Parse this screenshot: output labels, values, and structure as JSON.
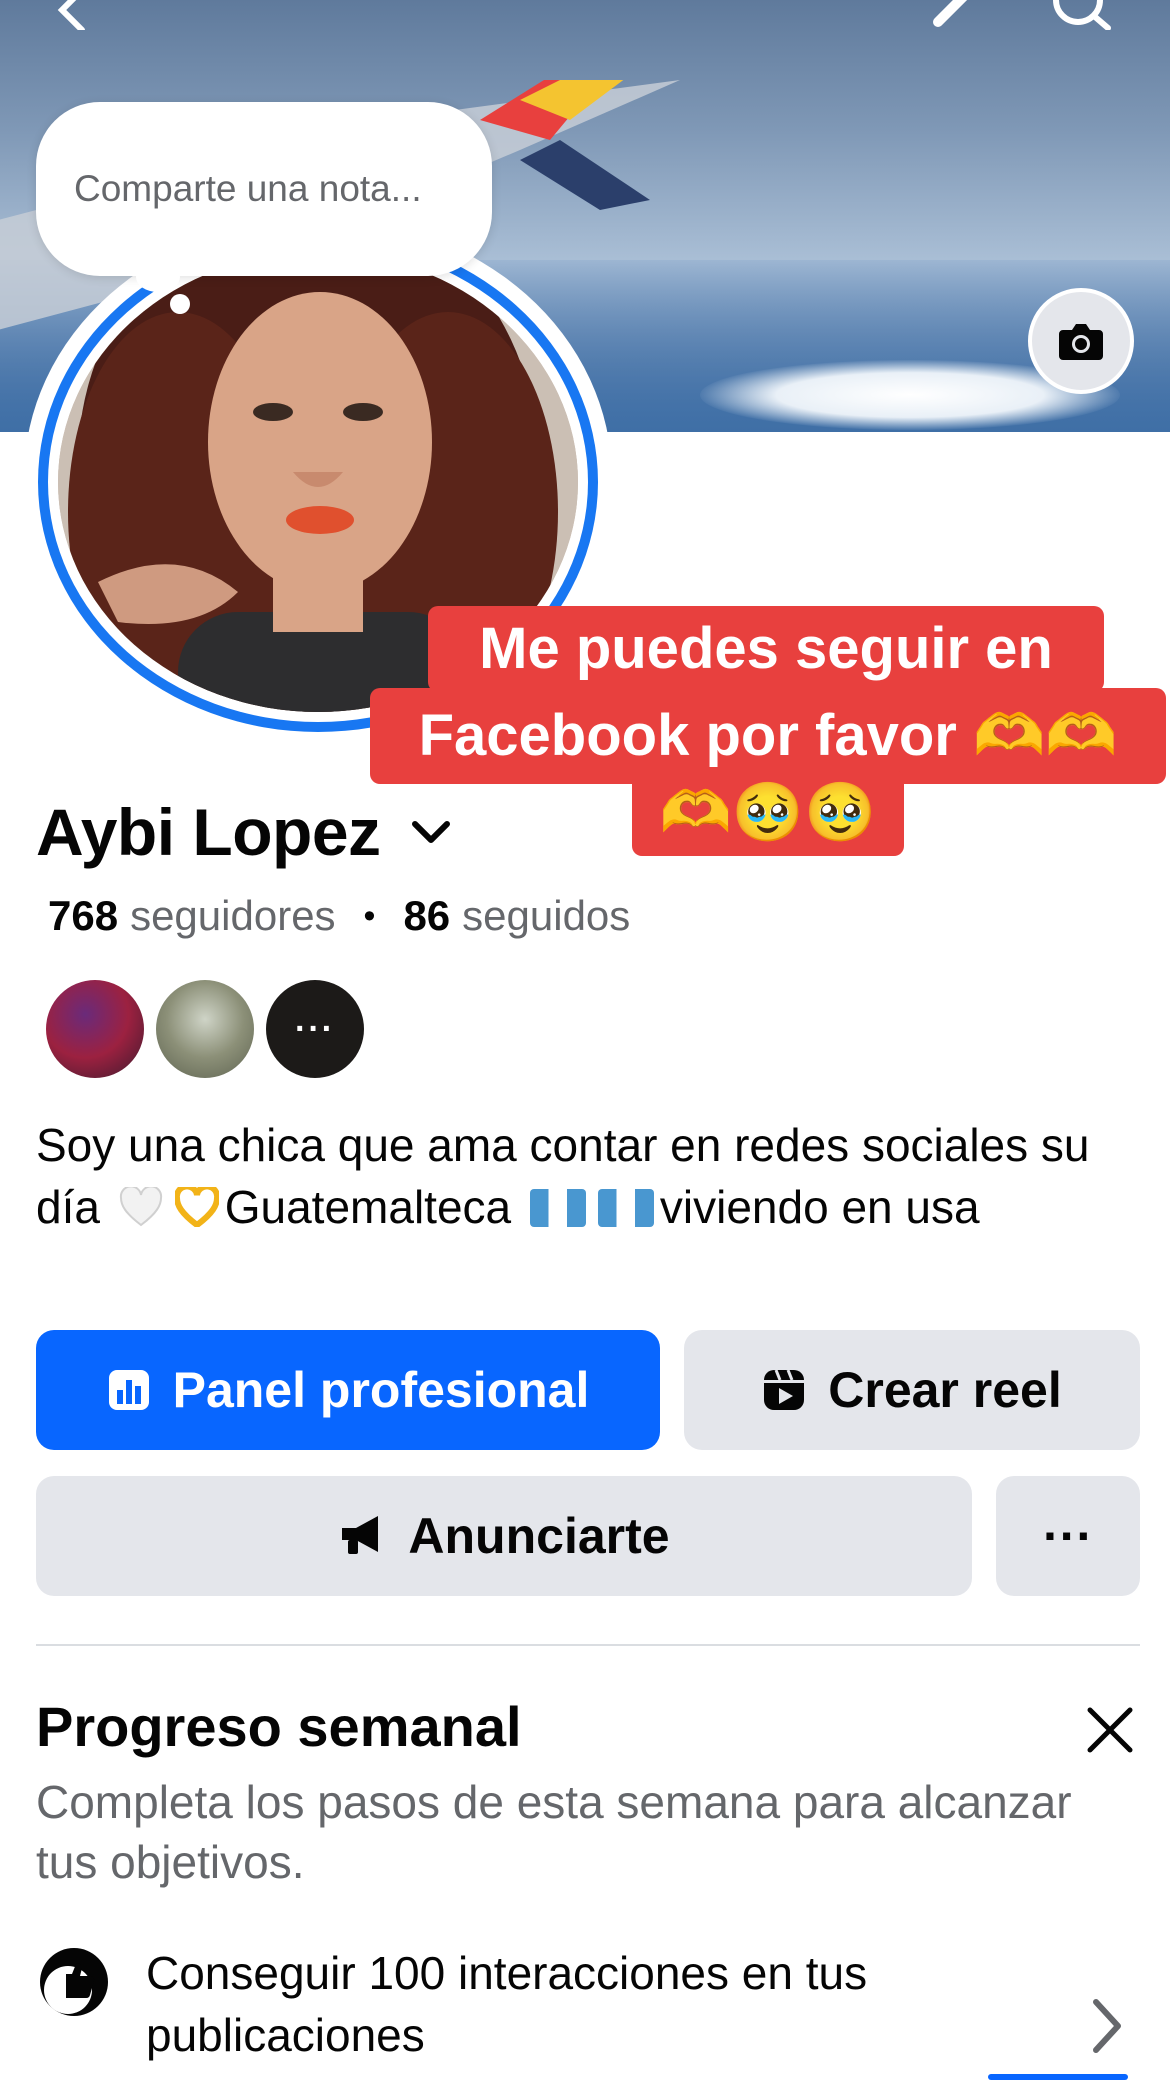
{
  "note": {
    "placeholder": "Comparte una nota..."
  },
  "caption": {
    "line1": "Me puedes seguir en",
    "line2": "Facebook por favor 🫶🫶",
    "line3": "🫶🥹🥹"
  },
  "profile": {
    "name": "Aybi Lopez",
    "followers_count": "768",
    "followers_label": "seguidores",
    "following_count": "86",
    "following_label": "seguidos",
    "bio_part1": "Soy una chica que ama contar en redes sociales su día",
    "bio_part2": "Guatemalteca",
    "bio_part3": "viviendo en usa"
  },
  "buttons": {
    "panel": "Panel profesional",
    "reel": "Crear reel",
    "ads": "Anunciarte",
    "more": "···"
  },
  "weekly": {
    "title": "Progreso semanal",
    "subtitle": "Completa los pasos de esta semana para alcanzar tus objetivos.",
    "task": "Conseguir 100 interacciones en tus publicaciones"
  },
  "friends_more": "···",
  "colors": {
    "accent": "#0866ff",
    "caption_bg": "#e8403e",
    "secondary_button": "#e4e6eb",
    "muted_text": "#65676b"
  },
  "icons": [
    "back-icon",
    "edit-icon",
    "search-icon",
    "camera-icon",
    "chevron-down-icon",
    "chart-icon",
    "reel-icon",
    "megaphone-icon",
    "more-icon",
    "close-icon",
    "thumbs-up-icon",
    "chevron-right-icon"
  ]
}
